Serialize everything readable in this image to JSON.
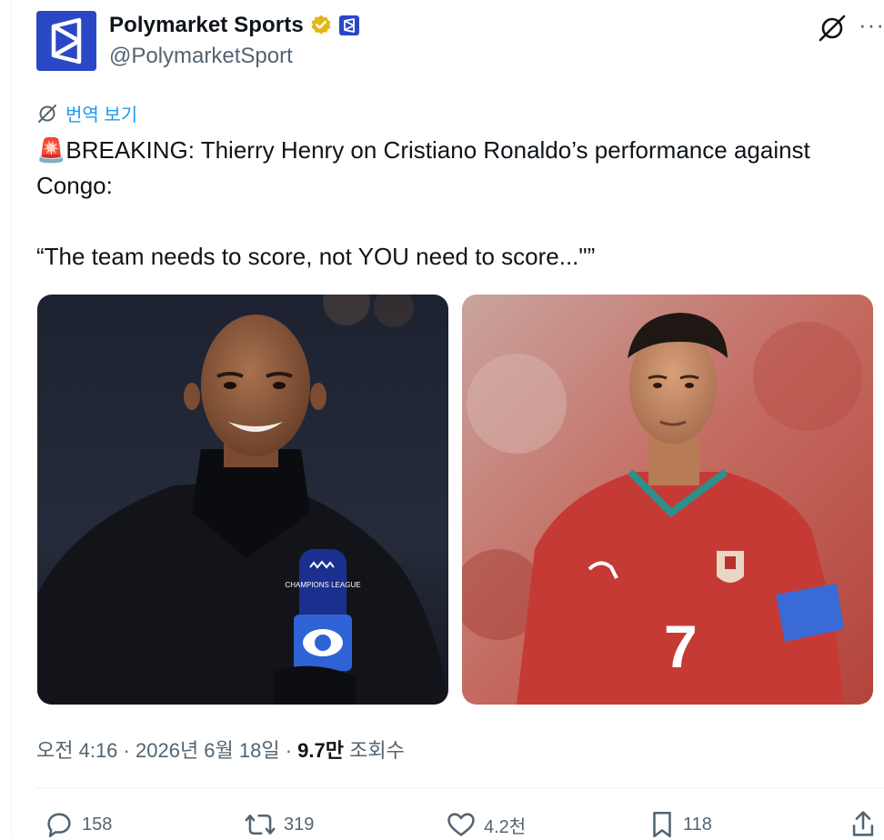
{
  "author": {
    "display_name": "Polymarket Sports",
    "handle": "@PolymarketSport"
  },
  "translate_label": "번역 보기",
  "tweet": {
    "emoji": "🚨",
    "line1": "BREAKING: Thierry Henry on Cristiano Ronaldo’s performance against Congo:",
    "quote": "“The team needs to score, not YOU need to score...\"”"
  },
  "media": {
    "left_alt": "Thierry Henry with a CBS Sports Champions League microphone",
    "right_alt": "Cristiano Ronaldo in a red Portugal kit, number 7",
    "mic_text": "CHAMPIONS LEAGUE",
    "jersey_number": "7"
  },
  "meta": {
    "time": "오전 4:16",
    "date": "2026년 6월 18일",
    "views": "9.7만",
    "views_label": "조회수",
    "sep": "·"
  },
  "actions": {
    "replies": "158",
    "reposts": "319",
    "likes": "4.2천",
    "bookmarks": "118"
  },
  "colors": {
    "brand": "#2a47c5",
    "link": "#1d9bf0",
    "verified": "#e2b719",
    "muted": "#536471"
  },
  "icons": [
    "verified-badge-icon",
    "affiliate-icon",
    "grok-icon",
    "more-icon",
    "translate-icon",
    "reply-icon",
    "repost-icon",
    "like-icon",
    "bookmark-icon",
    "share-icon"
  ]
}
